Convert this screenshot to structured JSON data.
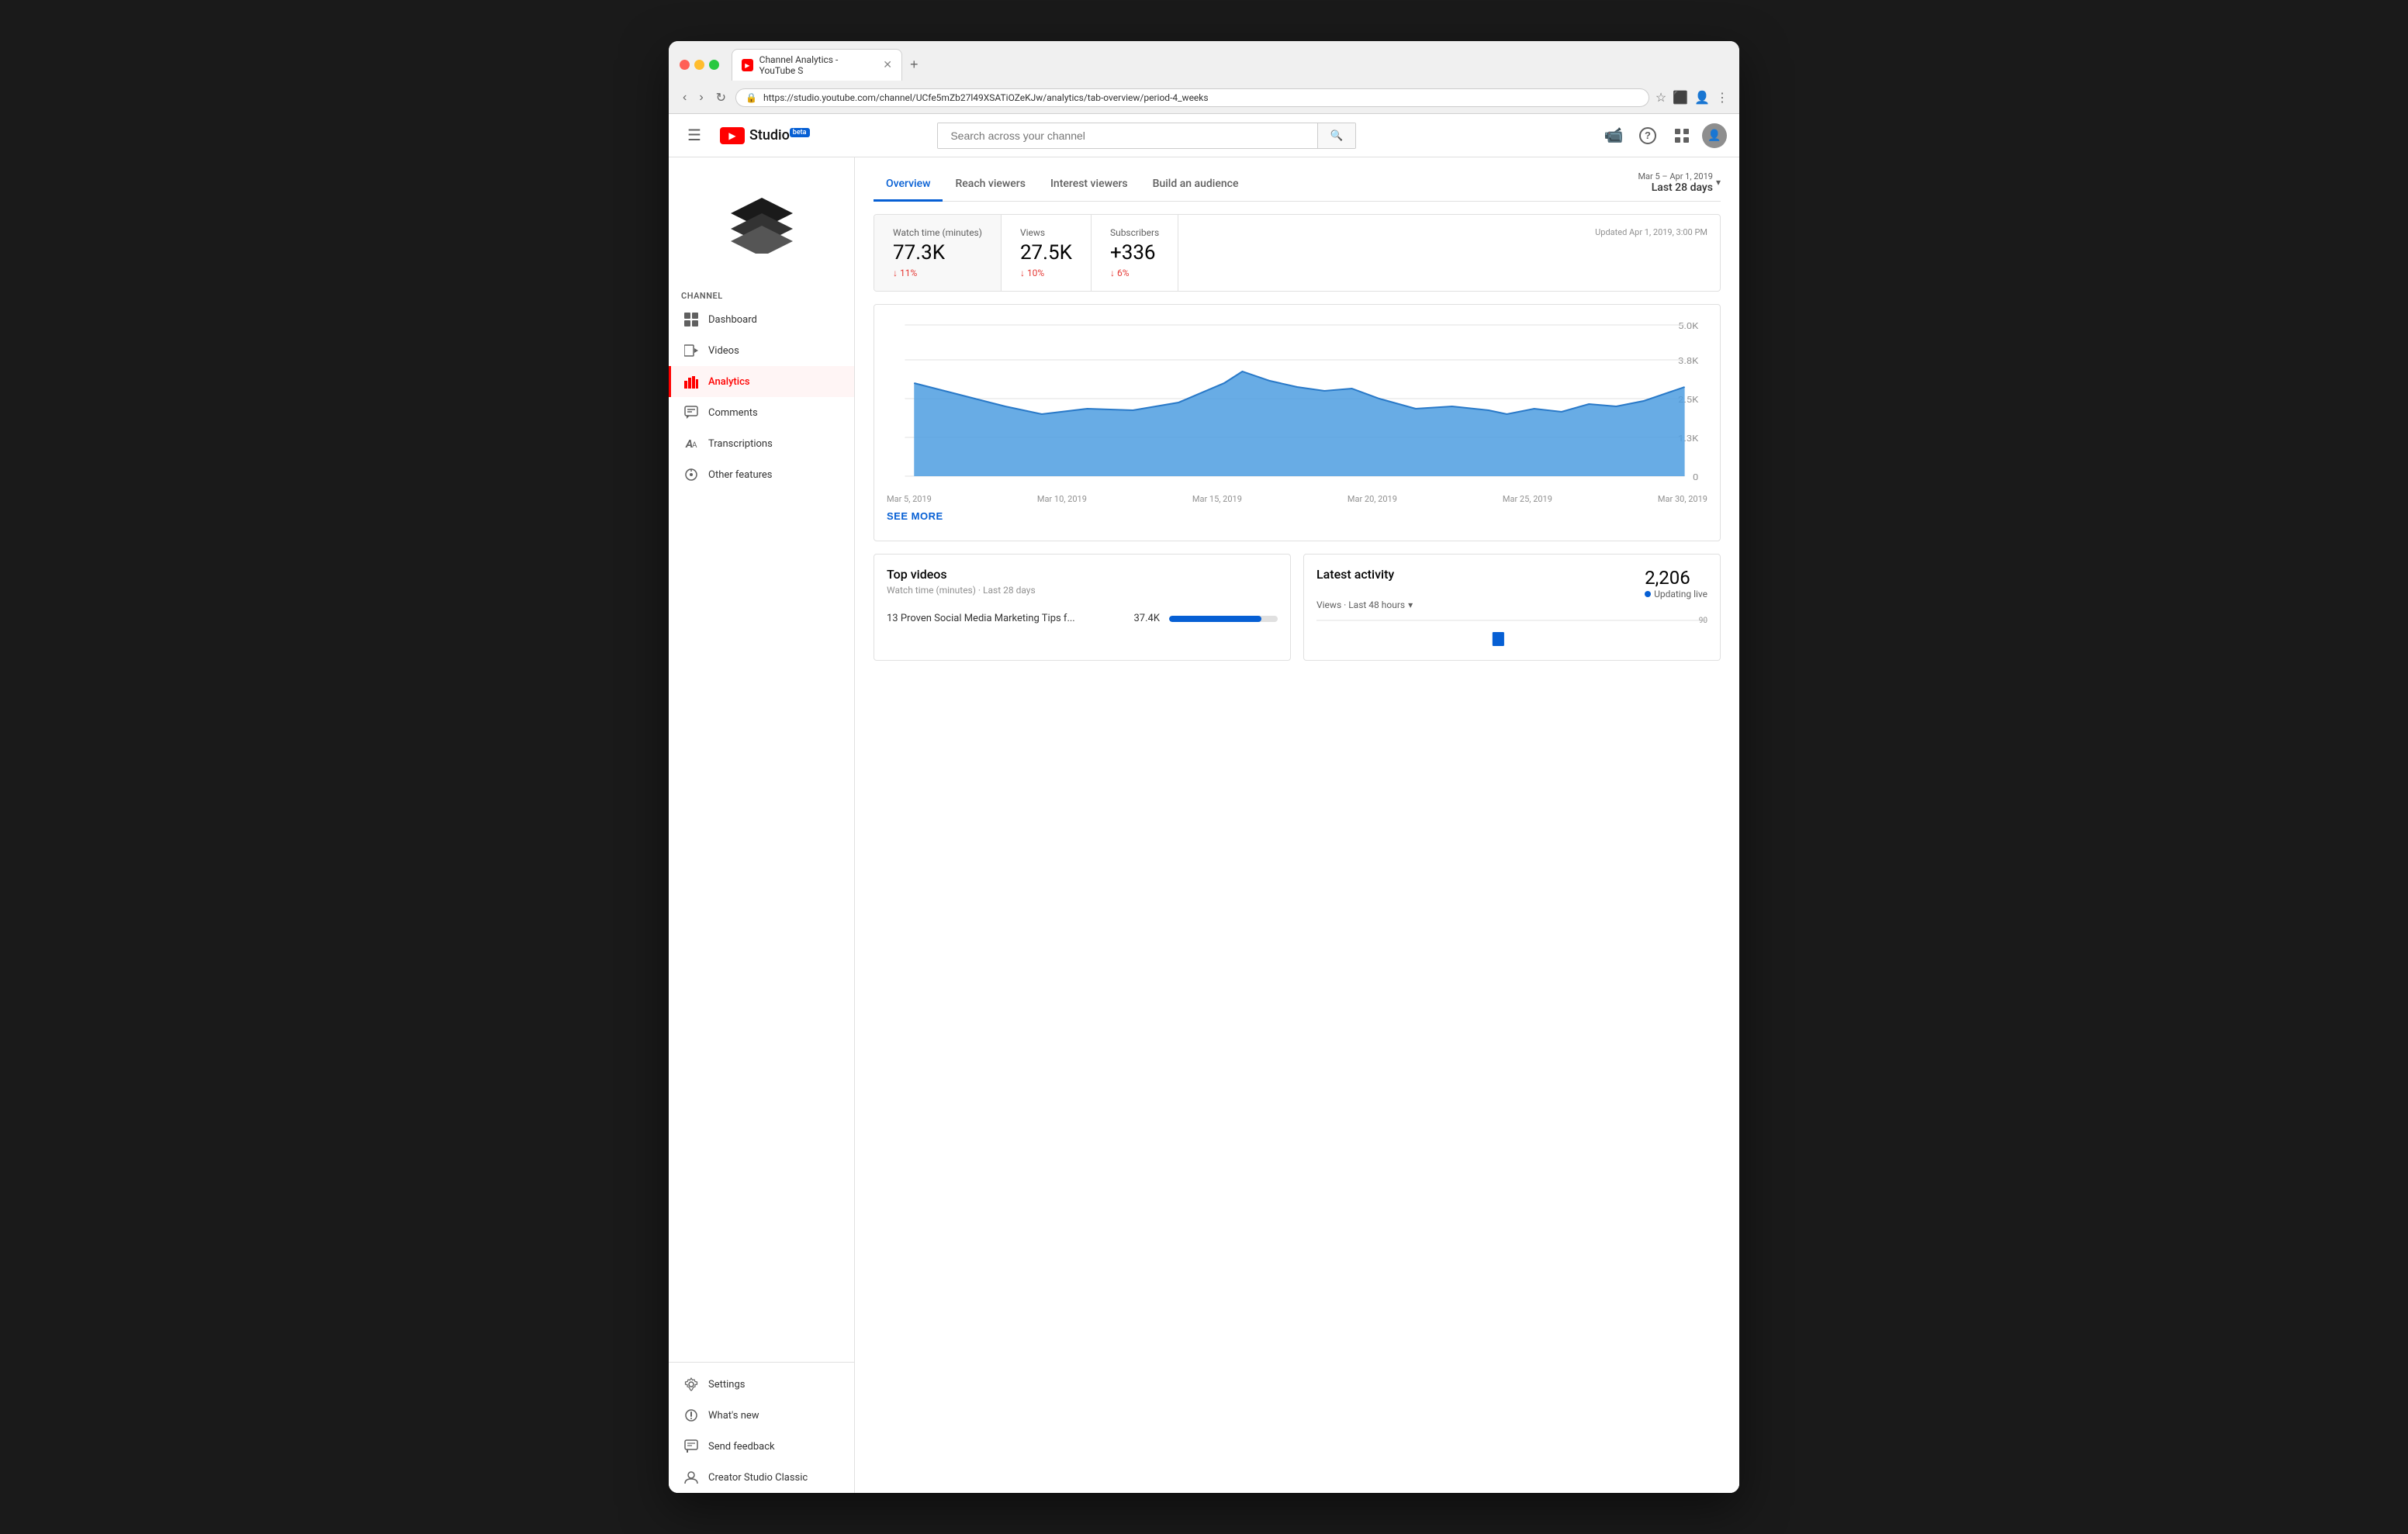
{
  "browser": {
    "url": "https://studio.youtube.com/channel/UCfe5mZb27l49XSATiOZeKJw/analytics/tab-overview/period-4_weeks",
    "tab_title": "Channel Analytics - YouTube S",
    "new_tab_label": "+"
  },
  "header": {
    "menu_icon": "☰",
    "studio_label": "Studio",
    "beta_label": "beta",
    "search_placeholder": "Search across your channel",
    "create_icon": "📹",
    "help_icon": "?",
    "apps_icon": "⬛"
  },
  "sidebar": {
    "section_label": "Channel",
    "items": [
      {
        "id": "dashboard",
        "label": "Dashboard",
        "icon": "⊞"
      },
      {
        "id": "videos",
        "label": "Videos",
        "icon": "▶"
      },
      {
        "id": "analytics",
        "label": "Analytics",
        "icon": "📊",
        "active": true
      },
      {
        "id": "comments",
        "label": "Comments",
        "icon": "💬"
      },
      {
        "id": "transcriptions",
        "label": "Transcriptions",
        "icon": "A"
      },
      {
        "id": "other-features",
        "label": "Other features",
        "icon": "🔍"
      }
    ],
    "bottom_items": [
      {
        "id": "settings",
        "label": "Settings",
        "icon": "⚙"
      },
      {
        "id": "whats-new",
        "label": "What's new",
        "icon": "🔔"
      },
      {
        "id": "send-feedback",
        "label": "Send feedback",
        "icon": "💬"
      },
      {
        "id": "creator-studio-classic",
        "label": "Creator Studio Classic",
        "icon": "👤"
      }
    ]
  },
  "page": {
    "title": "Channel Analytics YouTube",
    "tabs": [
      {
        "id": "overview",
        "label": "Overview",
        "active": true
      },
      {
        "id": "reach-viewers",
        "label": "Reach viewers",
        "active": false
      },
      {
        "id": "interest-viewers",
        "label": "Interest viewers",
        "active": false
      },
      {
        "id": "build-audience",
        "label": "Build an audience",
        "active": false
      }
    ],
    "date_range": {
      "sub": "Mar 5 – Apr 1, 2019",
      "main": "Last 28 days"
    },
    "updated_text": "Updated Apr 1, 2019, 3:00 PM",
    "stats": [
      {
        "id": "watch-time",
        "label": "Watch time (minutes)",
        "value": "77.3K",
        "change": "11%",
        "direction": "down"
      },
      {
        "id": "views",
        "label": "Views",
        "value": "27.5K",
        "change": "10%",
        "direction": "down"
      },
      {
        "id": "subscribers",
        "label": "Subscribers",
        "value": "+336",
        "change": "6%",
        "direction": "down"
      }
    ],
    "chart": {
      "x_labels": [
        "Mar 5, 2019",
        "Mar 10, 2019",
        "Mar 15, 2019",
        "Mar 20, 2019",
        "Mar 25, 2019",
        "Mar 30, 2019"
      ],
      "y_labels": [
        "5.0K",
        "3.8K",
        "2.5K",
        "1.3K",
        "0"
      ]
    },
    "see_more_label": "SEE MORE",
    "top_videos": {
      "title": "Top videos",
      "subtitle": "Watch time (minutes) · Last 28 days",
      "videos": [
        {
          "title": "13 Proven Social Media Marketing Tips f...",
          "views": "37.4K",
          "bar_pct": 85
        }
      ]
    },
    "latest_activity": {
      "title": "Latest activity",
      "views_count": "2,206",
      "subtitle": "Views · Last 48 hours",
      "updating_live": "Updating live",
      "y_label": "90"
    }
  }
}
